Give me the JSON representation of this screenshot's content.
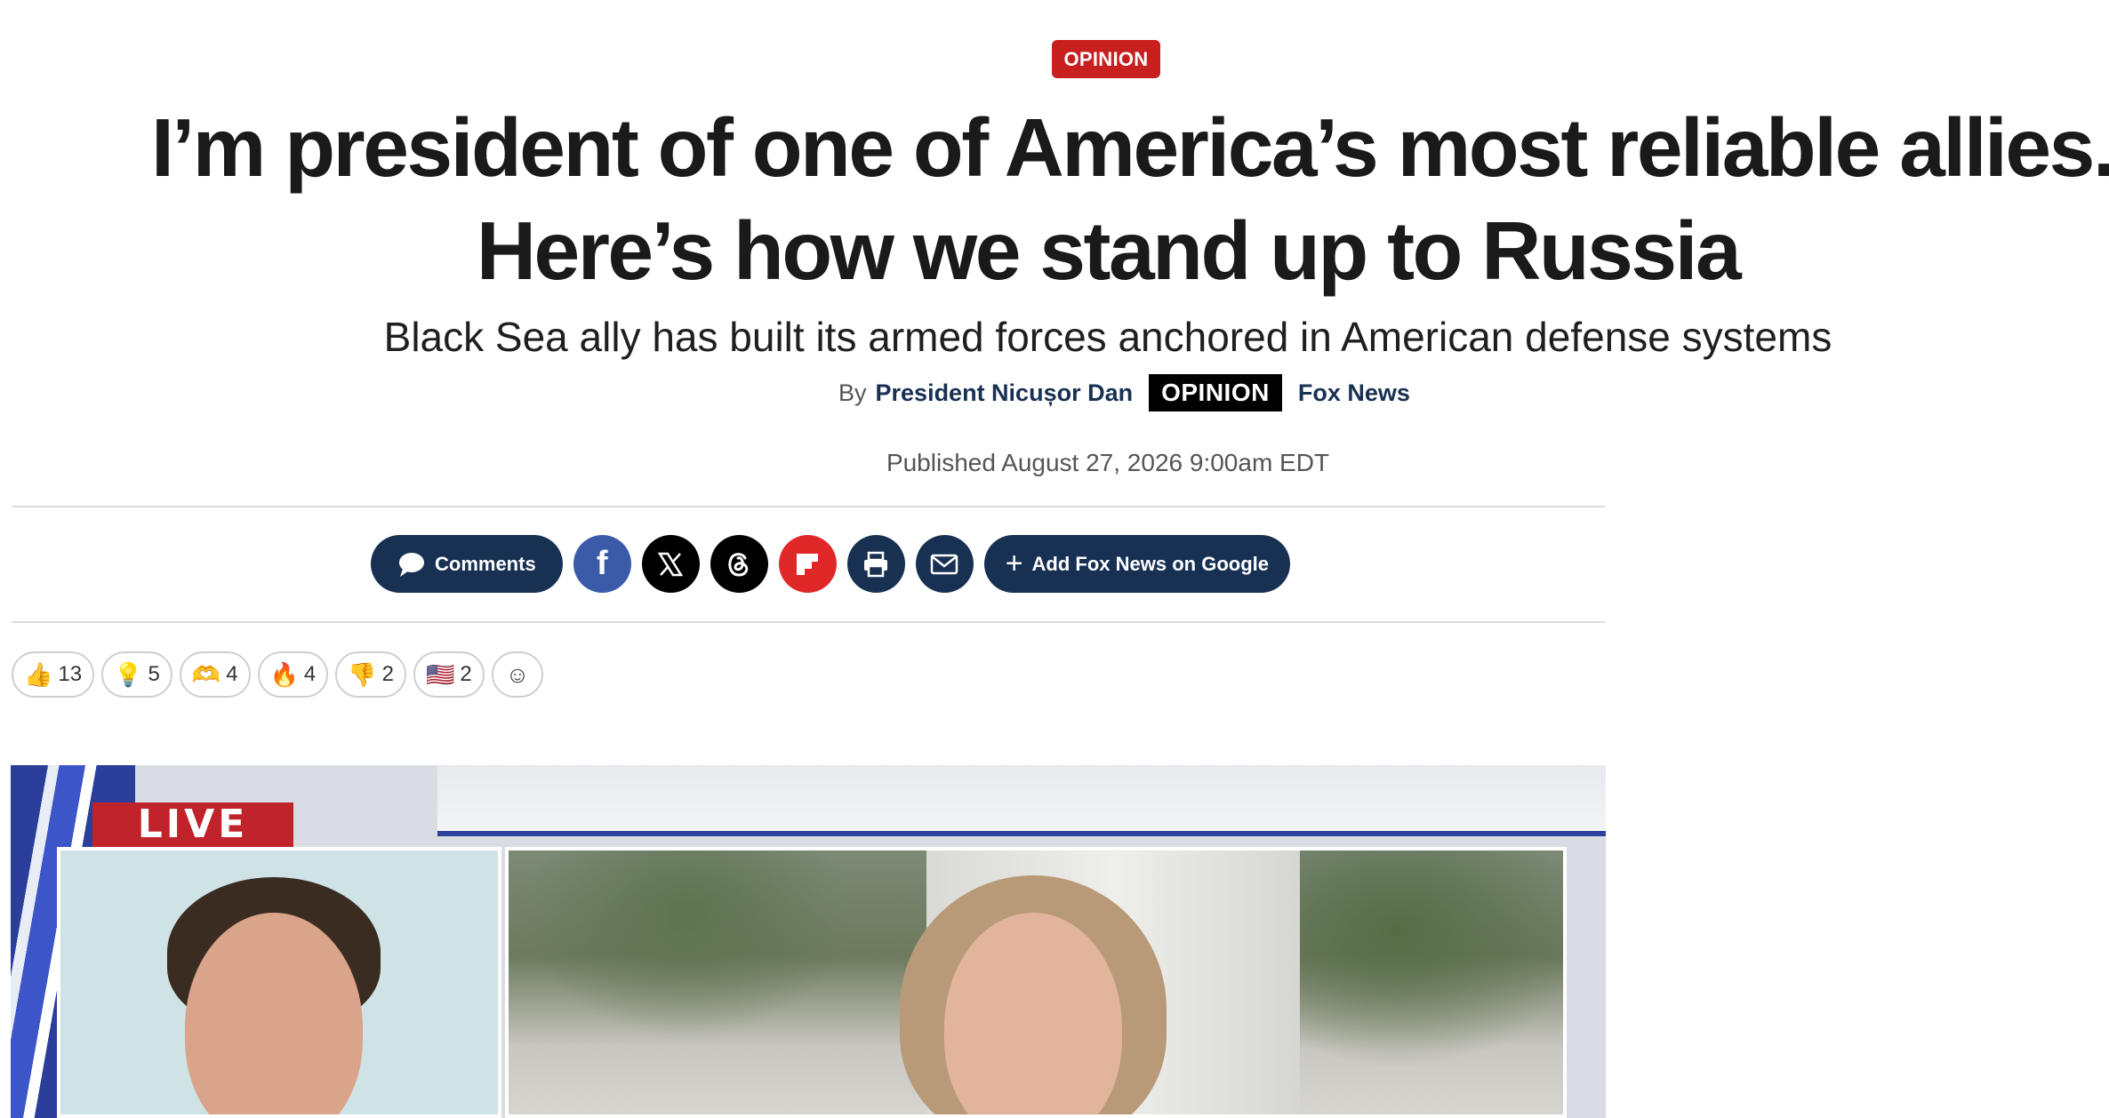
{
  "article": {
    "eyebrow": "OPINION",
    "headline_line1": "I’m president of one of America’s most reliable allies.",
    "headline_line2": "Here’s how we stand up to Russia",
    "dek": "Black Sea ally has built its armed forces anchored in American defense systems",
    "byline": {
      "by": "By",
      "author": "President Nicușor Dan",
      "badge": "OPINION",
      "outlet": "Fox News"
    },
    "published": "Published August 27, 2026 9:00am EDT"
  },
  "share": {
    "comments_label": "Comments",
    "icons": [
      {
        "name": "facebook-icon",
        "glyph": "f",
        "color": "#3b5ba8"
      },
      {
        "name": "x-icon",
        "glyph": "𝕏",
        "color": "#000000"
      },
      {
        "name": "threads-icon",
        "glyph": "@",
        "color": "#000000"
      },
      {
        "name": "flipboard-icon",
        "glyph": "F",
        "color": "#e12828"
      },
      {
        "name": "print-icon",
        "glyph": "⎙",
        "color": "#183153"
      },
      {
        "name": "email-icon",
        "glyph": "✉",
        "color": "#183153"
      }
    ],
    "google_label": "Add Fox News on Google",
    "google_plus": "+"
  },
  "reactions": [
    {
      "name": "thumbs-up",
      "emoji": "👍",
      "count": "13"
    },
    {
      "name": "lightbulb",
      "emoji": "💡",
      "count": "5"
    },
    {
      "name": "heart-hands",
      "emoji": "🫶",
      "count": "4"
    },
    {
      "name": "fire",
      "emoji": "🔥",
      "count": "4"
    },
    {
      "name": "thumbs-down",
      "emoji": "👎",
      "count": "2"
    },
    {
      "name": "us-flag",
      "emoji": "🇺🇸",
      "count": "2"
    },
    {
      "name": "add-reaction",
      "emoji": "☺",
      "count": ""
    }
  ],
  "video": {
    "live_label": "LIVE"
  },
  "colors": {
    "brand_red": "#c8201f",
    "brand_navy": "#183153"
  }
}
